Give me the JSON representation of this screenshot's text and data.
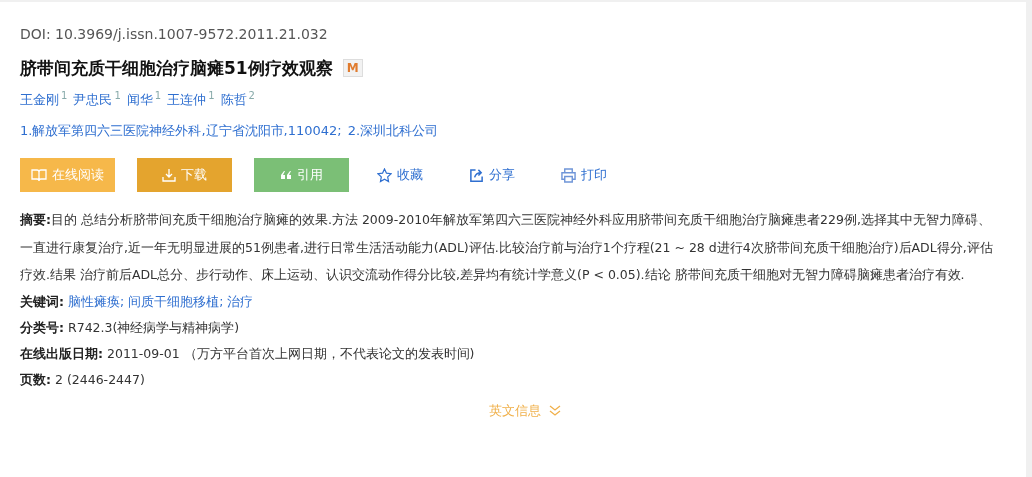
{
  "doi": "DOI: 10.3969/j.issn.1007-9572.2011.21.032",
  "title": "脐带间充质干细胞治疗脑瘫51例疗效观察",
  "title_badge": "M",
  "authors": [
    {
      "name": "王金刚",
      "mark": "1"
    },
    {
      "name": "尹忠民",
      "mark": "1"
    },
    {
      "name": "闻华",
      "mark": "1"
    },
    {
      "name": "王连仲",
      "mark": "1"
    },
    {
      "name": "陈哲",
      "mark": "2"
    }
  ],
  "affiliations": [
    "1.解放军第四六三医院神经外科,辽宁省沈阳市,110042;",
    "2.深圳北科公司"
  ],
  "actions": [
    {
      "kind": "read",
      "label": "在线阅读"
    },
    {
      "kind": "download",
      "label": "下载"
    },
    {
      "kind": "cite",
      "label": "引用"
    },
    {
      "kind": "favorite",
      "label": "收藏"
    },
    {
      "kind": "share",
      "label": "分享"
    },
    {
      "kind": "print",
      "label": "打印"
    }
  ],
  "abstract": {
    "label": "摘要:",
    "text": "目的 总结分析脐带间充质干细胞治疗脑瘫的效果.方法 2009-2010年解放军第四六三医院神经外科应用脐带间充质干细胞治疗脑瘫患者229例,选择其中无智力障碍、一直进行康复治疗,近一年无明显进展的51例患者,进行日常生活活动能力(ADL)评估.比较治疗前与治疗1个疗程(21 ~ 28 d进行4次脐带间充质干细胞治疗)后ADL得分,评估疗效.结果 治疗前后ADL总分、步行动作、床上运动、认识交流动作得分比较,差异均有统计学意义(P < 0.05).结论 脐带间充质干细胞对无智力障碍脑瘫患者治疗有效."
  },
  "keywords": {
    "label": "关键词:",
    "items": [
      "脑性瘫痪;",
      "间质干细胞移植;",
      "治疗"
    ]
  },
  "fields": [
    {
      "label": "分类号:",
      "value": "R742.3(神经病学与精神病学)"
    },
    {
      "label": "在线出版日期:",
      "value": "2011-09-01 （万方平台首次上网日期，不代表论文的发表时间)"
    },
    {
      "label": "页数:",
      "value": "2 (2446-2447)"
    }
  ],
  "more_link": "英文信息"
}
